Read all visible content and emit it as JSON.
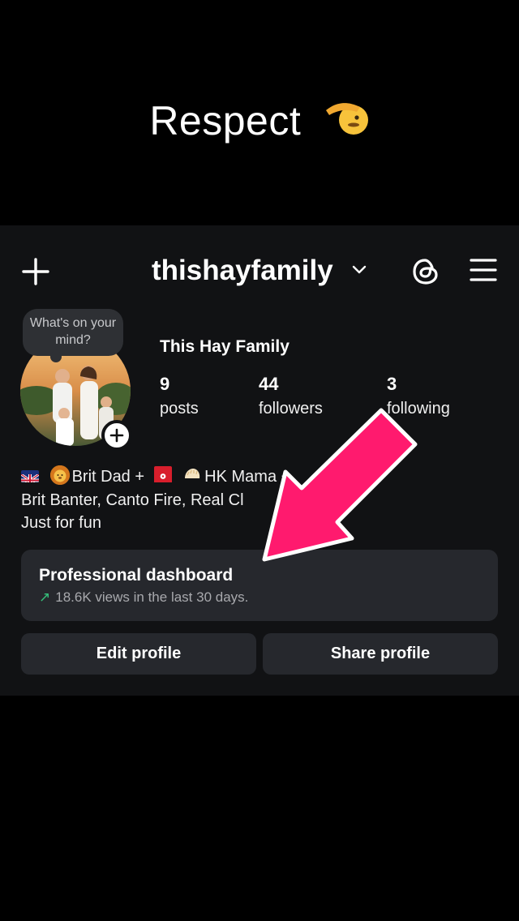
{
  "caption": {
    "text": "Respect",
    "emoji": "saluting-face"
  },
  "header": {
    "username": "thishayfamily",
    "icons": [
      "plus-icon",
      "chevron-down-icon",
      "threads-icon",
      "menu-icon"
    ]
  },
  "note": {
    "text": "What's on your mind?"
  },
  "profile": {
    "display_name": "This Hay Family",
    "stats": [
      {
        "value": "9",
        "label": "posts"
      },
      {
        "value": "44",
        "label": "followers"
      },
      {
        "value": "3",
        "label": "following"
      }
    ],
    "bio": {
      "line1_a": "Brit Dad +",
      "line1_b": "HK Mama +",
      "line2": "Brit Banter, Canto Fire, Real Cl",
      "line3": "Just for fun"
    }
  },
  "dashboard": {
    "title": "Professional dashboard",
    "subtitle": "18.6K views in the last 30 days."
  },
  "buttons": {
    "edit": "Edit profile",
    "share": "Share profile"
  },
  "colors": {
    "accent_arrow": "#ff1a6e",
    "trend_green": "#36c07b",
    "panel_bg": "#111214",
    "card_bg": "#26282d"
  }
}
